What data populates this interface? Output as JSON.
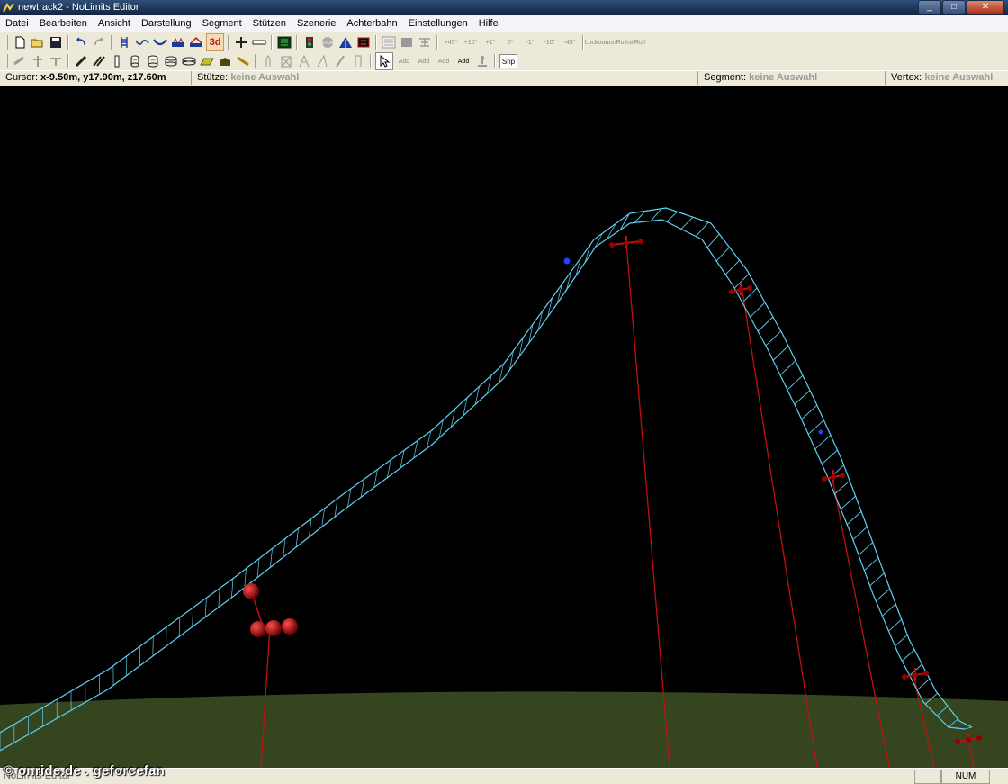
{
  "window": {
    "title": "newtrack2 - NoLimits Editor",
    "controls": [
      "minimize-icon",
      "maximize-icon",
      "close-icon"
    ]
  },
  "menubar": {
    "items": [
      "Datei",
      "Bearbeiten",
      "Ansicht",
      "Darstellung",
      "Segment",
      "Stützen",
      "Szenerie",
      "Achterbahn",
      "Einstellungen",
      "Hilfe"
    ]
  },
  "toolbar1": {
    "file_buttons": [
      "new-file-icon",
      "open-folder-icon",
      "save-disk-icon"
    ],
    "undo_redo": [
      "undo-icon",
      "redo-icon"
    ],
    "track_tools": [
      "track-rails-icon",
      "curve-icon",
      "valley-icon",
      "station-icon",
      "lift-icon"
    ],
    "mode_3d_label": "3d",
    "angle_labels": [
      "+45°",
      "+10°",
      "+1°",
      "0°",
      "-1°",
      "-10°",
      "-45°"
    ],
    "lock_labels": [
      {
        "top": "Lock",
        "bottom": "ooo"
      },
      {
        "top": "con",
        "bottom": "Roll"
      },
      {
        "top": "rel",
        "bottom": "Roll"
      }
    ]
  },
  "toolbar2": {
    "add_labels": [
      "Add",
      "Add",
      "Add",
      "Add"
    ],
    "snap_label": "Snp"
  },
  "status_top": {
    "cursor_label": "Cursor:",
    "cursor_value": "x-9.50m, y17.90m, z17.60m",
    "support_label": "Stütze:",
    "support_value": "keine Auswahl",
    "segment_label": "Segment:",
    "segment_value": "keine Auswahl",
    "vertex_label": "Vertex:",
    "vertex_value": "keine Auswahl"
  },
  "viewport": {
    "background_color": "#000000",
    "ground_color": "#34451f",
    "track_color": "#5fd0f0",
    "support_color": "#c01010",
    "vertex_color": "#2040ff"
  },
  "status_bottom": {
    "app_text": "NoLimits Editor",
    "num_label": "NUM"
  },
  "watermark": "© onride.de . geforcefan"
}
